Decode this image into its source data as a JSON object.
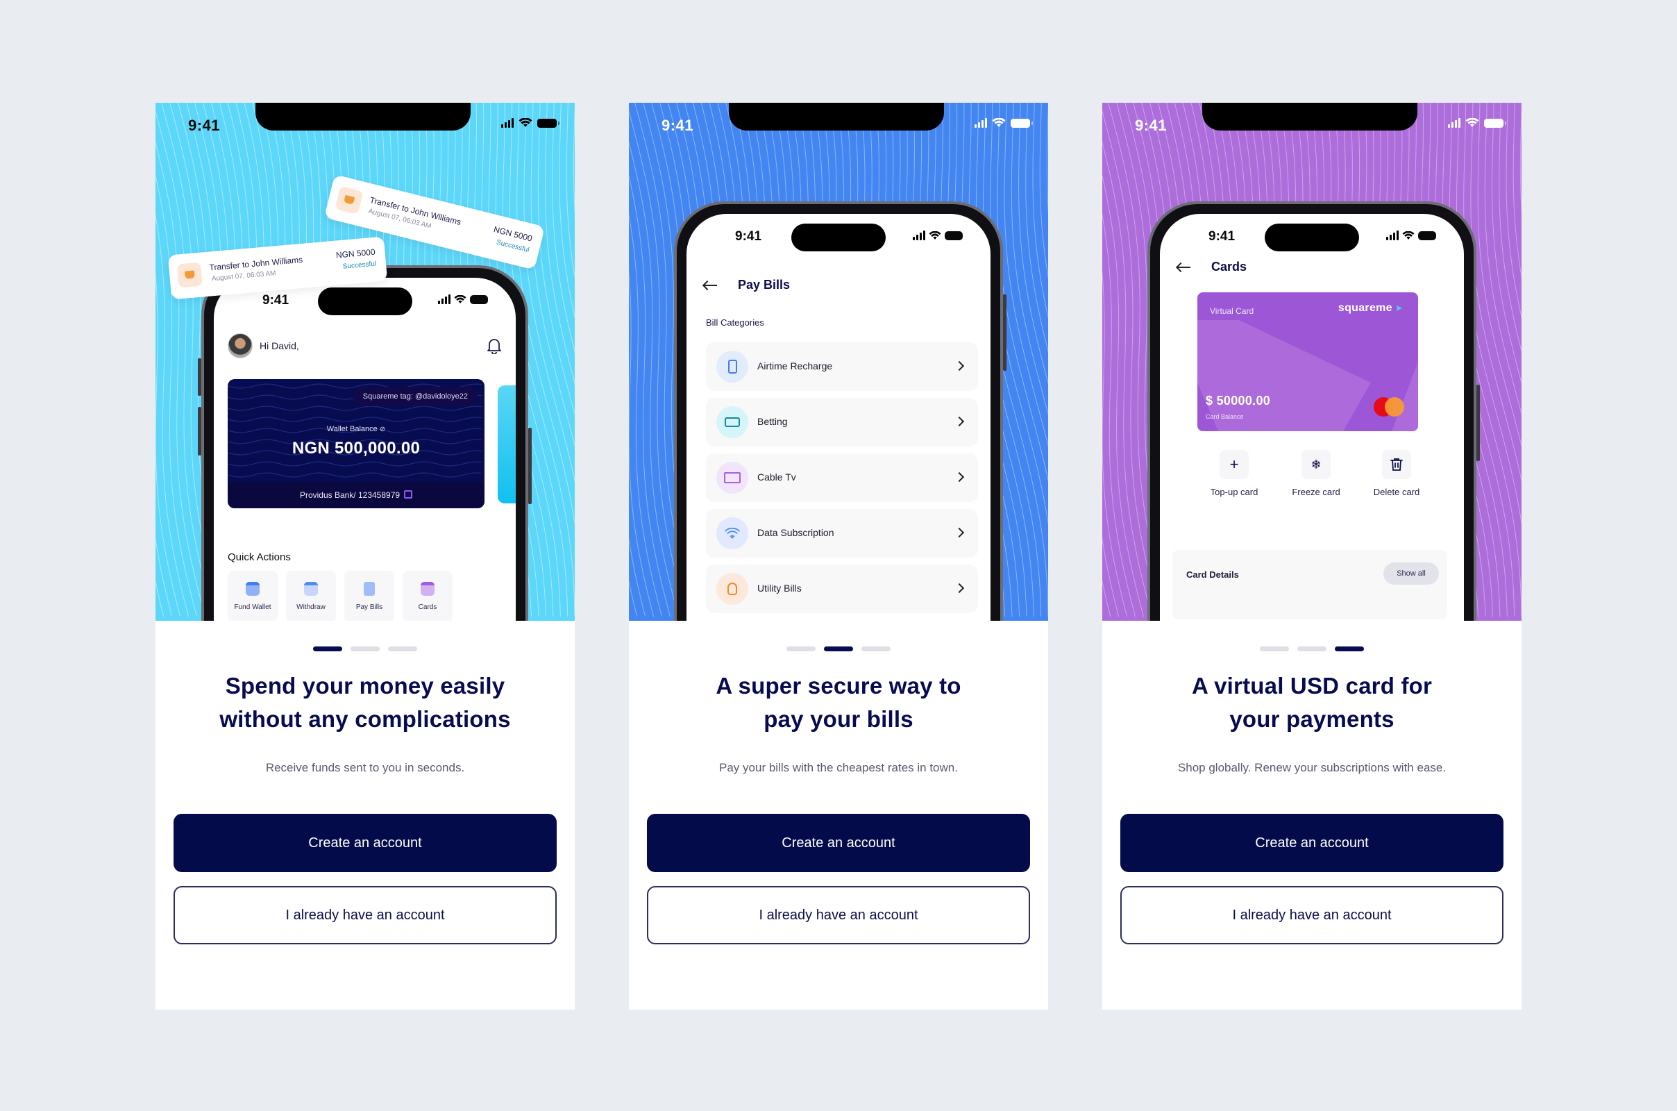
{
  "colors": {
    "page_bg": "#e9edf1",
    "navy": "#040b4a",
    "panel1_hero": "#5cd7fa",
    "panel2_hero": "#4386f2",
    "panel3_hero": "#ad6ddb"
  },
  "status_bar": {
    "time": "9:41"
  },
  "panels": [
    {
      "hero": {
        "notifications": [
          {
            "title": "Transfer to John Williams",
            "date": "August 07, 06:03 AM",
            "amount": "NGN 5000",
            "status": "Successful",
            "icon": "wallet-transfer-icon"
          },
          {
            "title": "Transfer to John Williams",
            "date": "August 07, 06:03 AM",
            "amount": "NGN 5000",
            "status": "Successful",
            "icon": "wallet-transfer-icon"
          }
        ],
        "screen": {
          "time": "9:41",
          "greeting": "Hi David,",
          "wallet": {
            "tag": "Squareme tag: @davidoloye22",
            "balance_label": "Wallet Balance",
            "balance": "NGN 500,000.00",
            "bank": "Providus Bank/ 123458979"
          },
          "quick_actions_title": "Quick Actions",
          "quick_actions": [
            {
              "label": "Fund Wallet",
              "icon": "fund-wallet-icon",
              "color": "#6a9ef5"
            },
            {
              "label": "Withdraw",
              "icon": "withdraw-icon",
              "color": "#8fb2f7"
            },
            {
              "label": "Pay Bills",
              "icon": "receipt-icon",
              "color": "#8fb2f7"
            },
            {
              "label": "Cards",
              "icon": "card-icon",
              "color": "#a66de0"
            }
          ]
        }
      },
      "active_dot": 0,
      "title_line1": "Spend your money easily",
      "title_line2": "without any complications",
      "subtitle": "Receive funds sent to you in seconds.",
      "primary_button": "Create an account",
      "secondary_button": "I already have an account"
    },
    {
      "hero": {
        "screen": {
          "time": "9:41",
          "title": "Pay Bills",
          "section_label": "Bill Categories",
          "items": [
            {
              "label": "Airtime Recharge",
              "icon": "phone-icon",
              "bg": "#e3ecfd",
              "fg": "#3f7ef0"
            },
            {
              "label": "Betting",
              "icon": "ticket-icon",
              "bg": "#d5f5fb",
              "fg": "#148a9c"
            },
            {
              "label": "Cable Tv",
              "icon": "tv-icon",
              "bg": "#f1e4fb",
              "fg": "#a660e0"
            },
            {
              "label": "Data Subscription",
              "icon": "wifi-icon",
              "bg": "#e2e8fd",
              "fg": "#4a8ef5"
            },
            {
              "label": "Utility Bills",
              "icon": "lightbulb-icon",
              "bg": "#fde9dc",
              "fg": "#f08a24"
            }
          ]
        }
      },
      "active_dot": 1,
      "title_line1": "A super secure way to",
      "title_line2": "pay your bills",
      "subtitle": "Pay your bills with the cheapest rates in town.",
      "primary_button": "Create an account",
      "secondary_button": "I already have an account"
    },
    {
      "hero": {
        "screen": {
          "time": "9:41",
          "title": "Cards",
          "card": {
            "type_label": "Virtual Card",
            "brand": "squareme",
            "balance": "$ 50000.00",
            "balance_label": "Card Balance"
          },
          "actions": [
            {
              "label": "Top-up card",
              "icon": "plus-icon",
              "glyph": "+"
            },
            {
              "label": "Freeze card",
              "icon": "snowflake-icon",
              "glyph": "❄"
            },
            {
              "label": "Delete card",
              "icon": "trash-icon",
              "glyph": "🗑"
            }
          ],
          "details_title": "Card Details",
          "show_all": "Show all"
        }
      },
      "active_dot": 2,
      "title_line1": "A virtual USD card for",
      "title_line2": "your payments",
      "subtitle": "Shop globally. Renew your subscriptions with ease.",
      "primary_button": "Create an account",
      "secondary_button": "I already have an account"
    }
  ]
}
